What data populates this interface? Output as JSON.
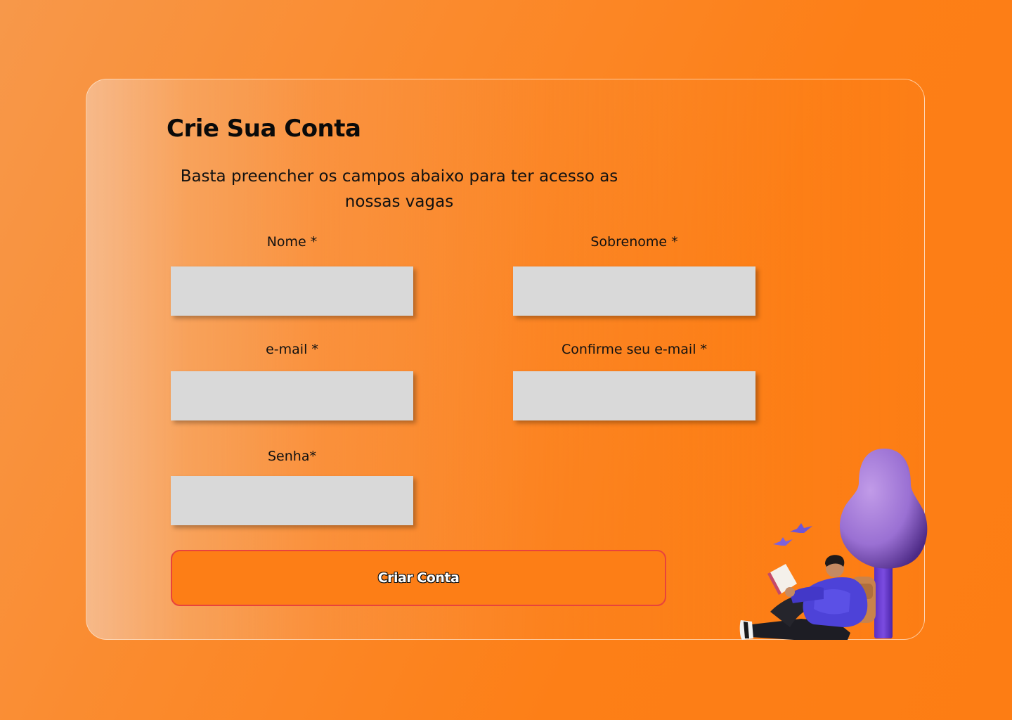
{
  "form": {
    "title": "Crie Sua Conta",
    "subtitle_line1": "Basta preencher os campos abaixo para ter acesso as",
    "subtitle_line2": "nossas vagas",
    "fields": {
      "first_name": {
        "label": "Nome *",
        "value": ""
      },
      "last_name": {
        "label": "Sobrenome *",
        "value": ""
      },
      "email": {
        "label": "e-mail *",
        "value": ""
      },
      "email_confirm": {
        "label": "Confirme seu e-mail *",
        "value": ""
      },
      "password": {
        "label": "Senha*",
        "value": ""
      }
    },
    "submit_label": "Criar Conta"
  },
  "illustration": {
    "icon": "person-reading-under-tree-illustration"
  },
  "colors": {
    "background": "#fd7e16",
    "button": "#fd7e16",
    "button_border": "#e8433c",
    "input": "#d9d9d9",
    "tree": "#9b72d6",
    "trunk": "#6b3fd1"
  }
}
